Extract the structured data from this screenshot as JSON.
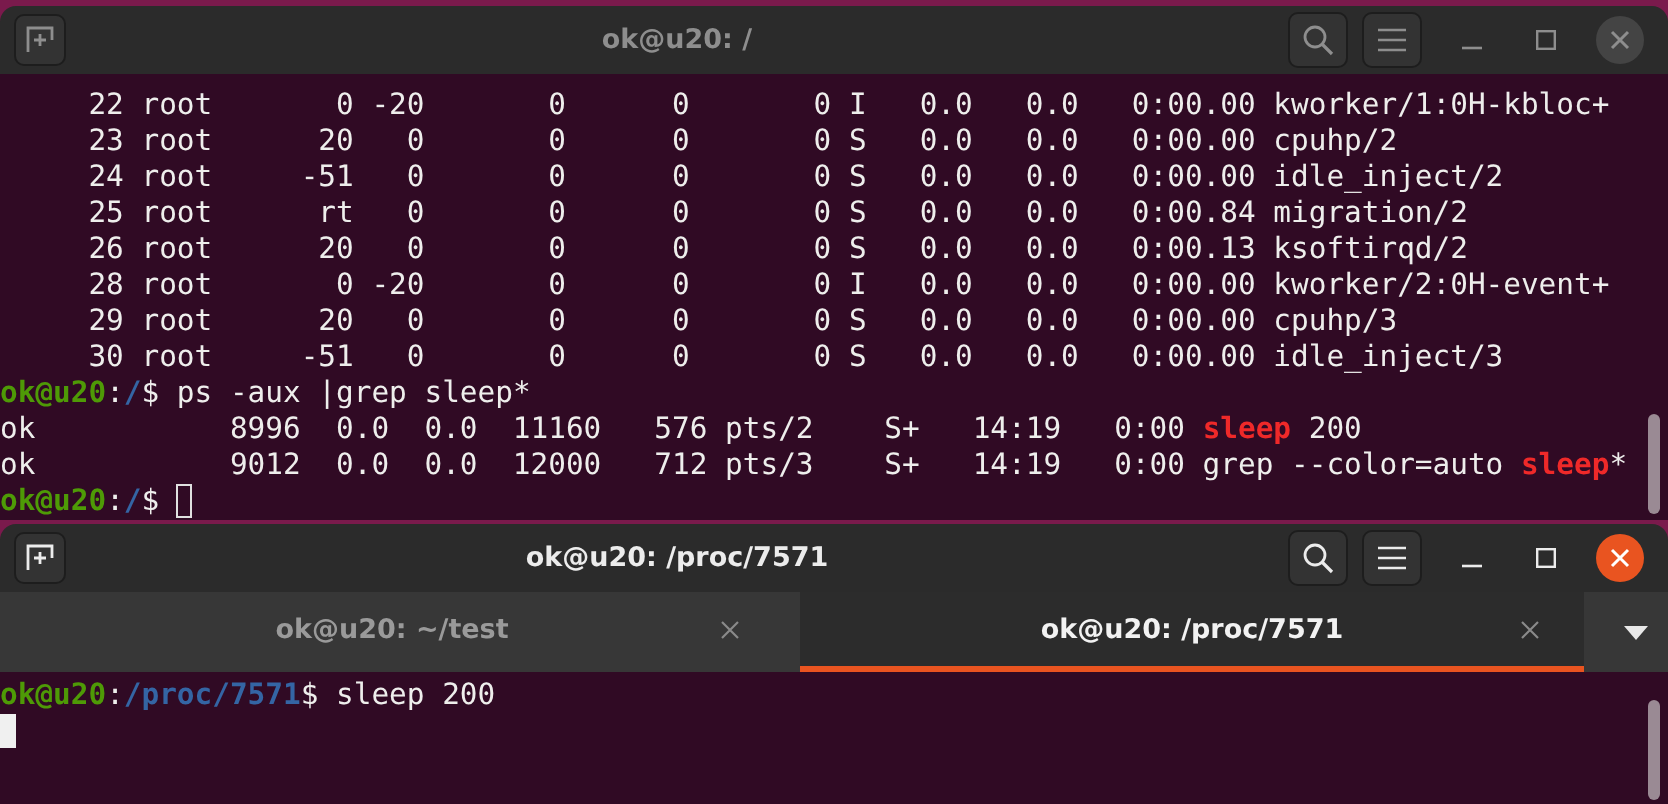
{
  "windows": [
    {
      "title": "ok@u20: /",
      "active": false,
      "lines": [
        [
          {
            "kind": "text",
            "text": "     22 root       0 -20       0      0       0 I   0.0   0.0   0:00.00 kworker/1:0H-kbloc+"
          }
        ],
        [
          {
            "kind": "text",
            "text": "     23 root      20   0       0      0       0 S   0.0   0.0   0:00.00 cpuhp/2"
          }
        ],
        [
          {
            "kind": "text",
            "text": "     24 root     -51   0       0      0       0 S   0.0   0.0   0:00.00 idle_inject/2"
          }
        ],
        [
          {
            "kind": "text",
            "text": "     25 root      rt   0       0      0       0 S   0.0   0.0   0:00.84 migration/2"
          }
        ],
        [
          {
            "kind": "text",
            "text": "     26 root      20   0       0      0       0 S   0.0   0.0   0:00.13 ksoftirqd/2"
          }
        ],
        [
          {
            "kind": "text",
            "text": "     28 root       0 -20       0      0       0 I   0.0   0.0   0:00.00 kworker/2:0H-event+"
          }
        ],
        [
          {
            "kind": "text",
            "text": "     29 root      20   0       0      0       0 S   0.0   0.0   0:00.00 cpuhp/3"
          }
        ],
        [
          {
            "kind": "text",
            "text": "     30 root     -51   0       0      0       0 S   0.0   0.0   0:00.00 idle_inject/3"
          }
        ],
        [
          {
            "kind": "user",
            "text": "ok@u20"
          },
          {
            "kind": "text",
            "text": ":"
          },
          {
            "kind": "path",
            "text": "/"
          },
          {
            "kind": "text",
            "text": "$ ps -aux |grep sleep*"
          }
        ],
        [
          {
            "kind": "text",
            "text": "ok           8996  0.0  0.0  11160   576 pts/2    S+   14:19   0:00 "
          },
          {
            "kind": "match",
            "text": "sleep"
          },
          {
            "kind": "text",
            "text": " 200"
          }
        ],
        [
          {
            "kind": "text",
            "text": "ok           9012  0.0  0.0  12000   712 pts/3    S+   14:19   0:00 grep --color=auto "
          },
          {
            "kind": "match",
            "text": "sleep"
          },
          {
            "kind": "text",
            "text": "*"
          }
        ],
        [
          {
            "kind": "user",
            "text": "ok@u20"
          },
          {
            "kind": "text",
            "text": ":"
          },
          {
            "kind": "path",
            "text": "/"
          },
          {
            "kind": "text",
            "text": "$ "
          },
          {
            "kind": "cursor"
          }
        ]
      ]
    },
    {
      "title": "ok@u20: /proc/7571",
      "active": true,
      "tabs": [
        {
          "label": "ok@u20: ~/test",
          "selected": false
        },
        {
          "label": "ok@u20: /proc/7571",
          "selected": true
        }
      ],
      "lines": [
        [
          {
            "kind": "user",
            "text": "ok@u20"
          },
          {
            "kind": "text",
            "text": ":"
          },
          {
            "kind": "path",
            "text": "/proc/7571"
          },
          {
            "kind": "text",
            "text": "$ sleep 200"
          }
        ],
        [
          {
            "kind": "cursor"
          }
        ]
      ]
    }
  ]
}
